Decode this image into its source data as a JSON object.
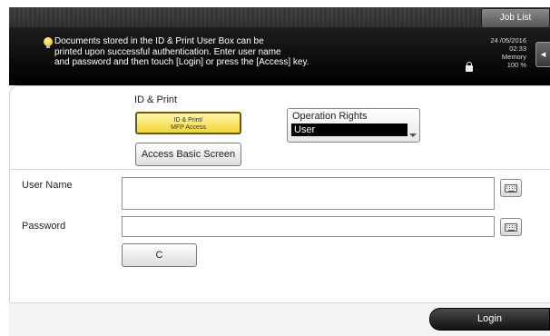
{
  "header": {
    "job_list_label": "Job List",
    "message_lines": [
      "Documents stored in the ID & Print User Box can be",
      "printed upon successful authentication. Enter user name",
      "and password and then touch [Login] or press the [Access] key."
    ],
    "status": {
      "date": "24 /05/2016",
      "time": "02:33",
      "memory_label": "Memory",
      "memory_value": "100 %"
    },
    "side_tab_glyph": "◂"
  },
  "id_print": {
    "section_label": "ID & Print",
    "idprint_button_line1": "ID & Print/",
    "idprint_button_line2": "MFP Access",
    "access_basic_label": "Access Basic Screen"
  },
  "operation_rights": {
    "label": "Operation Rights",
    "selected": "User"
  },
  "form": {
    "user_name_label": "User Name",
    "user_name_value": "",
    "password_label": "Password",
    "password_value": "",
    "clear_label": "C"
  },
  "footer": {
    "login_label": "Login"
  },
  "colors": {
    "idprint_button": "#f3d534",
    "header_bg": "#000000",
    "login_button": "#111111"
  }
}
